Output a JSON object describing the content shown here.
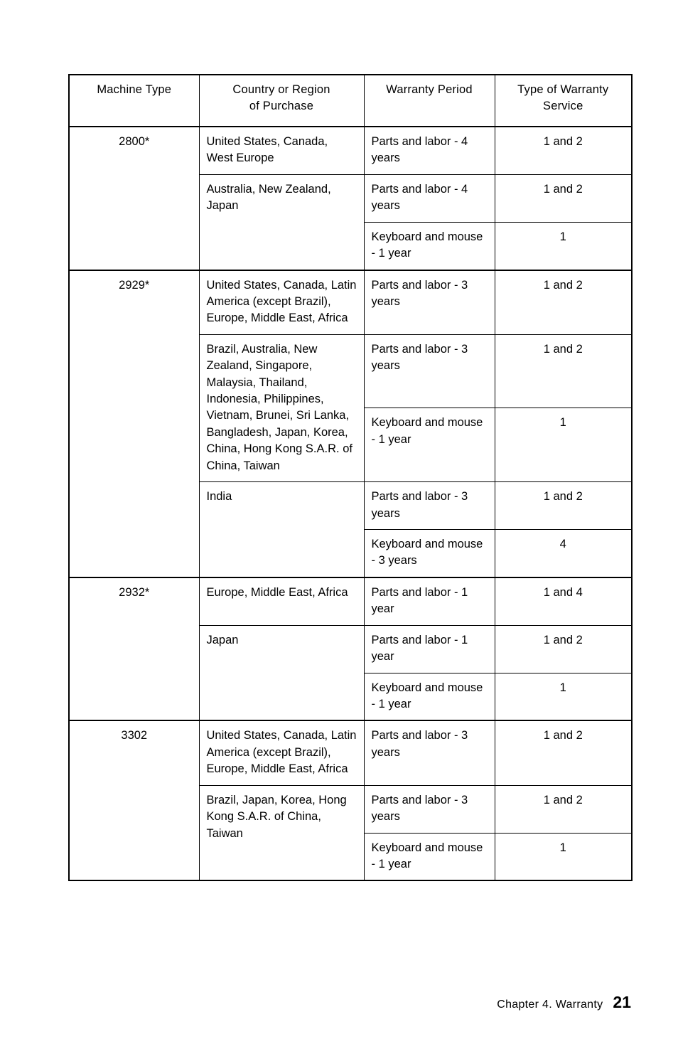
{
  "table": {
    "headers": [
      "Machine Type",
      [
        "Country or Region",
        "of Purchase"
      ],
      "Warranty Period",
      [
        "Type of Warranty",
        "Service"
      ]
    ],
    "header_machine_type": "Machine Type",
    "header_country_line1": "Country or Region",
    "header_country_line2": "of Purchase",
    "header_warranty_period": "Warranty Period",
    "header_service_line1": "Type of Warranty",
    "header_service_line2": "Service",
    "groups": [
      {
        "machine_type": "2800*",
        "countries": [
          {
            "name": "United States, Canada, West Europe",
            "rows": [
              {
                "period": "Parts and labor - 4 years",
                "service": "1 and 2"
              }
            ]
          },
          {
            "name": "Australia, New Zealand, Japan",
            "rows": [
              {
                "period": "Parts and labor - 4 years",
                "service": "1 and 2"
              },
              {
                "period": "Keyboard and mouse - 1 year",
                "service": "1"
              }
            ]
          }
        ]
      },
      {
        "machine_type": "2929*",
        "countries": [
          {
            "name": "United States, Canada, Latin America (except Brazil), Europe, Middle East, Africa",
            "rows": [
              {
                "period": "Parts and labor - 3 years",
                "service": "1 and 2"
              }
            ]
          },
          {
            "name": "Brazil, Australia, New Zealand, Singapore, Malaysia, Thailand, Indonesia, Philippines, Vietnam, Brunei, Sri Lanka, Bangladesh, Japan, Korea, China, Hong Kong S.A.R. of China, Taiwan",
            "rows": [
              {
                "period": "Parts and labor - 3 years",
                "service": "1 and 2"
              },
              {
                "period": "Keyboard and mouse - 1 year",
                "service": "1"
              }
            ]
          },
          {
            "name": "India",
            "rows": [
              {
                "period": "Parts and labor - 3 years",
                "service": "1 and 2"
              },
              {
                "period": "Keyboard and mouse - 3 years",
                "service": "4"
              }
            ]
          }
        ]
      },
      {
        "machine_type": "2932*",
        "countries": [
          {
            "name": "Europe, Middle East, Africa",
            "rows": [
              {
                "period": "Parts and labor - 1 year",
                "service": "1 and 4"
              }
            ]
          },
          {
            "name": "Japan",
            "rows": [
              {
                "period": "Parts and labor - 1 year",
                "service": "1 and 2"
              },
              {
                "period": "Keyboard and mouse - 1 year",
                "service": "1"
              }
            ]
          }
        ]
      },
      {
        "machine_type": "3302",
        "countries": [
          {
            "name": "United States, Canada, Latin America (except Brazil), Europe, Middle East, Africa",
            "rows": [
              {
                "period": "Parts and labor - 3 years",
                "service": "1 and 2"
              }
            ]
          },
          {
            "name": "Brazil, Japan, Korea, Hong Kong S.A.R. of China, Taiwan",
            "rows": [
              {
                "period": "Parts and labor - 3 years",
                "service": "1 and 2"
              },
              {
                "period": "Keyboard and mouse - 1 year",
                "service": "1"
              }
            ]
          }
        ]
      }
    ]
  },
  "footer": {
    "chapter": "Chapter 4.  Warranty",
    "page_number": "21"
  }
}
